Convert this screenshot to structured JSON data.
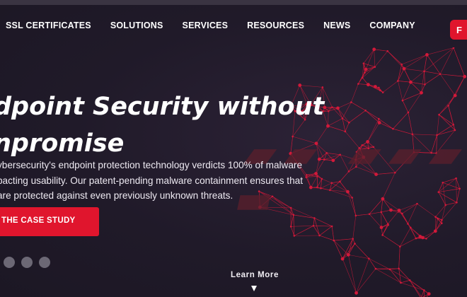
{
  "nav": {
    "items": [
      {
        "label": "SSL CERTIFICATES"
      },
      {
        "label": "SOLUTIONS"
      },
      {
        "label": "SERVICES"
      },
      {
        "label": "RESOURCES"
      },
      {
        "label": "NEWS"
      },
      {
        "label": "COMPANY"
      }
    ],
    "cta_label": "F"
  },
  "hero": {
    "headline_line1": "dpoint Security without",
    "headline_line2": "npromise",
    "description_lines": [
      "ybersecurity's endpoint protection technology verdicts 100% of malware",
      "pacting usability. Our patent-pending malware containment ensures that",
      "are protected against even previously unknown threats."
    ],
    "button_label": "THE CASE STUDY",
    "carousel_dots": 3,
    "learn_more_label": "Learn More"
  },
  "colors": {
    "background": "#221c2c",
    "accent": "#e0152d",
    "mesh": "#d2193a",
    "text": "#ffffff"
  },
  "icons": {
    "scroll_indicator": "triangle-down-icon"
  }
}
